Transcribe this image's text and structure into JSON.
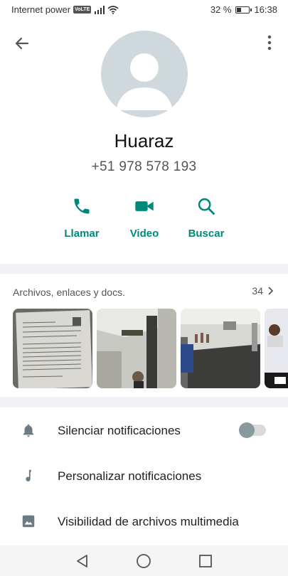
{
  "status_bar": {
    "carrier": "Internet power",
    "network_badge": "VoLTE",
    "battery_percent": "32 %",
    "battery_level": 0.32,
    "time": "16:38"
  },
  "contact": {
    "name": "Huaraz",
    "phone": "+51 978 578 193"
  },
  "actions": [
    {
      "label": "Llamar",
      "icon": "phone-icon"
    },
    {
      "label": "Video",
      "icon": "video-icon"
    },
    {
      "label": "Buscar",
      "icon": "search-icon"
    }
  ],
  "media": {
    "title": "Archivos, enlaces y docs.",
    "count": "34"
  },
  "settings": [
    {
      "label": "Silenciar notificaciones",
      "icon": "bell-icon",
      "toggle": false
    },
    {
      "label": "Personalizar notificaciones",
      "icon": "music-note-icon"
    },
    {
      "label": "Visibilidad de archivos multimedia",
      "icon": "image-icon"
    }
  ],
  "colors": {
    "accent": "#00897b",
    "avatar_bg": "#cfd8dc"
  }
}
